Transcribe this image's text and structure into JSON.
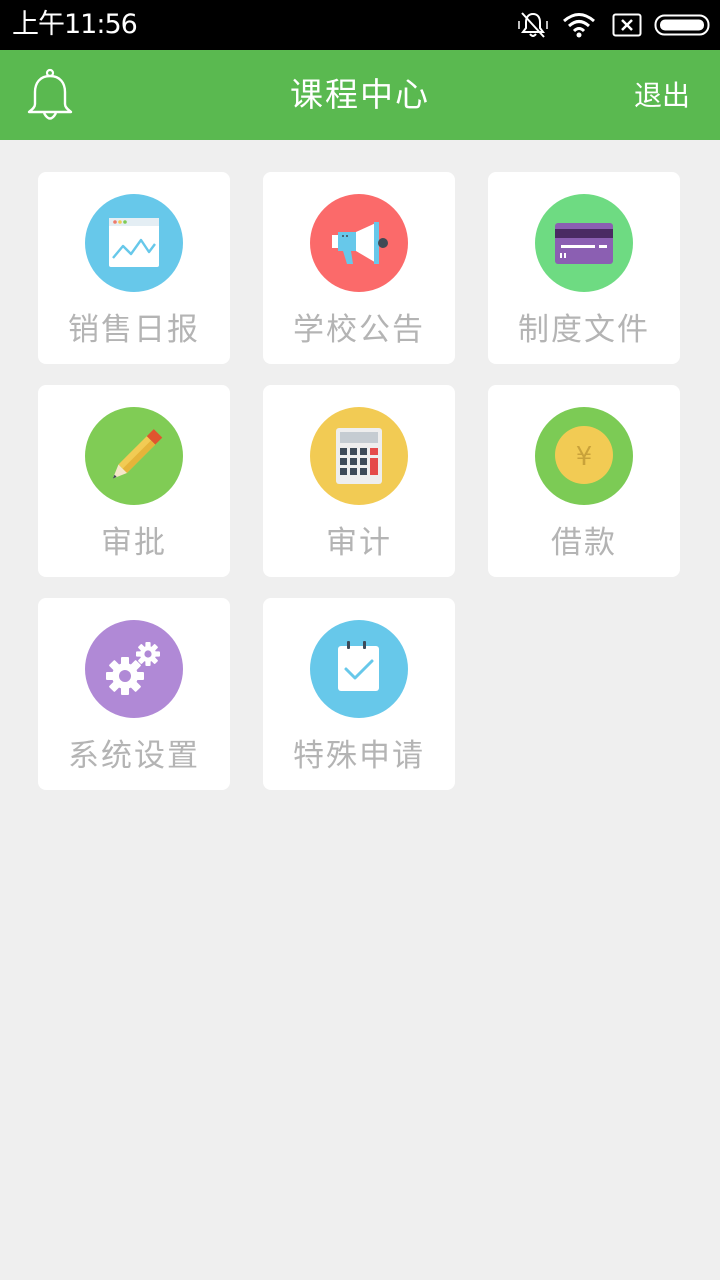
{
  "status_bar": {
    "time": "上午11:56",
    "icons": [
      "vibrate-off-icon",
      "wifi-icon",
      "sim-none-icon",
      "battery-icon"
    ]
  },
  "header": {
    "title": "课程中心",
    "logout_label": "退出",
    "bell_icon": "bell-icon",
    "background": "#5ab950"
  },
  "tiles": [
    {
      "label": "销售日报",
      "icon": "chart-icon",
      "color": "#67c8ea"
    },
    {
      "label": "学校公告",
      "icon": "megaphone-icon",
      "color": "#fb6a6a"
    },
    {
      "label": "制度文件",
      "icon": "card-icon",
      "color": "#6edb82"
    },
    {
      "label": "审批",
      "icon": "pencil-icon",
      "color": "#80cc55"
    },
    {
      "label": "审计",
      "icon": "calculator-icon",
      "color": "#f2cb54"
    },
    {
      "label": "借款",
      "icon": "coin-icon",
      "color": "#7ccb55",
      "coin_symbol": "¥"
    },
    {
      "label": "系统设置",
      "icon": "gears-icon",
      "color": "#b089d6"
    },
    {
      "label": "特殊申请",
      "icon": "checklist-icon",
      "color": "#67c8ea"
    }
  ]
}
